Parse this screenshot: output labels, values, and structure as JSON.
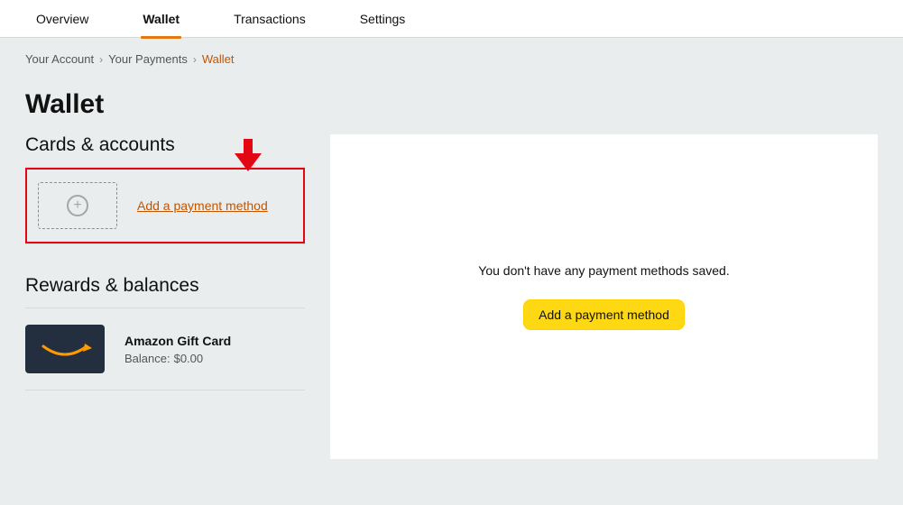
{
  "tabs": {
    "overview": "Overview",
    "wallet": "Wallet",
    "transactions": "Transactions",
    "settings": "Settings",
    "active": "wallet"
  },
  "breadcrumbs": {
    "your_account": "Your Account",
    "your_payments": "Your Payments",
    "wallet": "Wallet"
  },
  "title": "Wallet",
  "sections": {
    "cards": {
      "heading": "Cards & accounts",
      "add_label": "Add a payment method"
    },
    "rewards": {
      "heading": "Rewards & balances",
      "gift_card": {
        "name": "Amazon Gift Card",
        "balance_label": "Balance:",
        "balance_value": "$0.00"
      }
    }
  },
  "main_panel": {
    "empty_message": "You don't have any payment methods saved.",
    "cta_label": "Add a payment method"
  },
  "colors": {
    "accent_orange": "#e47911",
    "link_orange": "#c45500",
    "annotation_red": "#e30613",
    "primary_yellow": "#ffd814",
    "navy": "#232f3e"
  }
}
